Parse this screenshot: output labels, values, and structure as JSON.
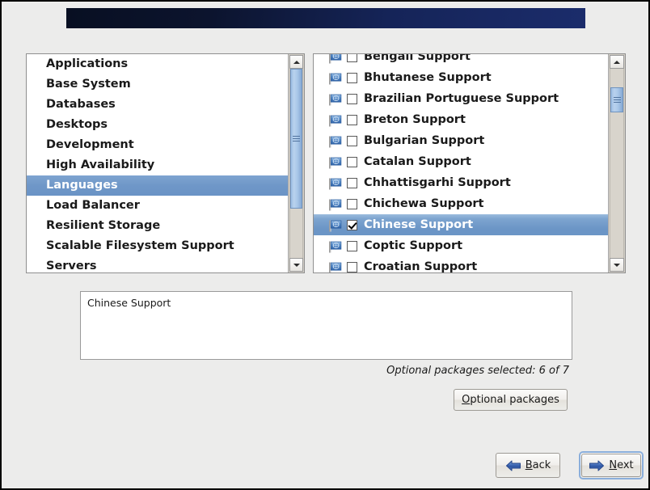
{
  "window": {
    "banner_color_start": "#080f22",
    "banner_color_end": "#1b2c6b"
  },
  "theme": {
    "selection_blue": "#6b95c6",
    "scrollbar_thumb": "#a9c7e8",
    "panel_background": "#ffffff",
    "window_background": "#ececeb",
    "focus_ring": "#8aaedb"
  },
  "category_list": {
    "name": "environment-group-list",
    "items": [
      {
        "label": "Applications",
        "selected": false
      },
      {
        "label": "Base System",
        "selected": false
      },
      {
        "label": "Databases",
        "selected": false
      },
      {
        "label": "Desktops",
        "selected": false
      },
      {
        "label": "Development",
        "selected": false
      },
      {
        "label": "High Availability",
        "selected": false
      },
      {
        "label": "Languages",
        "selected": true
      },
      {
        "label": "Load Balancer",
        "selected": false
      },
      {
        "label": "Resilient Storage",
        "selected": false
      },
      {
        "label": "Scalable Filesystem Support",
        "selected": false
      },
      {
        "label": "Servers",
        "selected": false
      }
    ],
    "scrollbar": {
      "up_arrow": "scroll-up-arrow",
      "down_arrow": "scroll-down-arrow",
      "thumb_top_pct": 0,
      "thumb_height_pct": 74
    }
  },
  "package_list": {
    "name": "package-group-list",
    "icon": "flag-icon",
    "items": [
      {
        "label": "Bengali Support",
        "checked": false,
        "selected": false
      },
      {
        "label": "Bhutanese Support",
        "checked": false,
        "selected": false
      },
      {
        "label": "Brazilian Portuguese Support",
        "checked": false,
        "selected": false
      },
      {
        "label": "Breton Support",
        "checked": false,
        "selected": false
      },
      {
        "label": "Bulgarian Support",
        "checked": false,
        "selected": false
      },
      {
        "label": "Catalan Support",
        "checked": false,
        "selected": false
      },
      {
        "label": "Chhattisgarhi Support",
        "checked": false,
        "selected": false
      },
      {
        "label": "Chichewa Support",
        "checked": false,
        "selected": false
      },
      {
        "label": "Chinese Support",
        "checked": true,
        "selected": true
      },
      {
        "label": "Coptic Support",
        "checked": false,
        "selected": false
      },
      {
        "label": "Croatian Support",
        "checked": false,
        "selected": false
      }
    ],
    "scrollbar": {
      "up_arrow": "scroll-up-arrow",
      "down_arrow": "scroll-down-arrow",
      "thumb_top_pct": 10,
      "thumb_height_pct": 13
    }
  },
  "description": {
    "text": "Chinese Support"
  },
  "status": {
    "optional_packages_text": "Optional packages selected: 6 of 7"
  },
  "buttons": {
    "optional_packages": {
      "mnemonic": "O",
      "rest": "ptional packages"
    },
    "back": {
      "mnemonic": "B",
      "rest": "ack",
      "icon": "arrow-left-icon"
    },
    "next": {
      "mnemonic": "N",
      "rest": "ext",
      "icon": "arrow-right-icon",
      "focused": true
    }
  }
}
